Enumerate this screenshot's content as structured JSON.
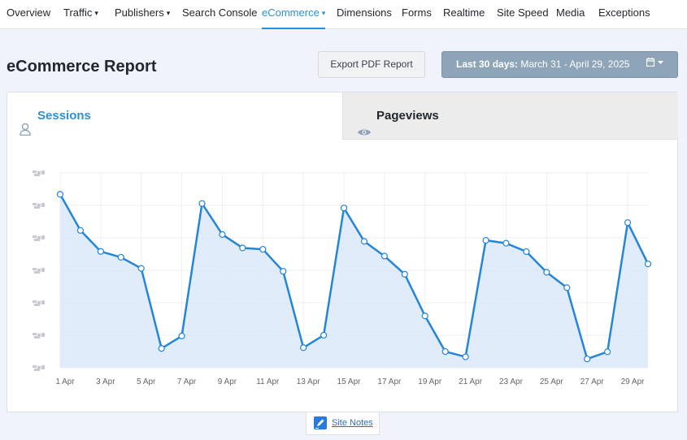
{
  "nav": {
    "items": [
      {
        "label": "Overview",
        "dropdown": false,
        "active": false
      },
      {
        "label": "Traffic",
        "dropdown": true,
        "active": false
      },
      {
        "label": "Publishers",
        "dropdown": true,
        "active": false
      },
      {
        "label": "Search Console",
        "dropdown": false,
        "active": false
      },
      {
        "label": "eCommerce",
        "dropdown": true,
        "active": true
      },
      {
        "label": "Dimensions",
        "dropdown": false,
        "active": false
      },
      {
        "label": "Forms",
        "dropdown": false,
        "active": false
      },
      {
        "label": "Realtime",
        "dropdown": false,
        "active": false
      },
      {
        "label": "Site Speed",
        "dropdown": false,
        "active": false
      },
      {
        "label": "Media",
        "dropdown": false,
        "active": false
      },
      {
        "label": "Exceptions",
        "dropdown": false,
        "active": false
      }
    ]
  },
  "header": {
    "title": "eCommerce Report",
    "export_label": "Export PDF Report",
    "date_prefix": "Last 30 days:",
    "date_range": "March 31 - April 29, 2025"
  },
  "tabs": {
    "sessions": "Sessions",
    "pageviews": "Pageviews"
  },
  "site_notes": "Site Notes",
  "colors": {
    "accent": "#2b91d8",
    "line": "#2585d6",
    "area": "#dbe9f8"
  },
  "chart_data": {
    "type": "area",
    "x": [
      "1 Apr",
      "2 Apr",
      "3 Apr",
      "4 Apr",
      "5 Apr",
      "6 Apr",
      "7 Apr",
      "8 Apr",
      "9 Apr",
      "10 Apr",
      "11 Apr",
      "12 Apr",
      "13 Apr",
      "14 Apr",
      "15 Apr",
      "16 Apr",
      "17 Apr",
      "18 Apr",
      "19 Apr",
      "20 Apr",
      "21 Apr",
      "22 Apr",
      "23 Apr",
      "24 Apr",
      "25 Apr",
      "26 Apr",
      "27 Apr",
      "28 Apr",
      "29 Apr",
      "30 Apr"
    ],
    "tick_labels": [
      "1 Apr",
      "3 Apr",
      "5 Apr",
      "7 Apr",
      "9 Apr",
      "11 Apr",
      "13 Apr",
      "15 Apr",
      "17 Apr",
      "19 Apr",
      "21 Apr",
      "23 Apr",
      "25 Apr",
      "27 Apr",
      "29 Apr"
    ],
    "y_relative": [
      0.89,
      0.705,
      0.597,
      0.567,
      0.51,
      0.099,
      0.163,
      0.843,
      0.684,
      0.615,
      0.608,
      0.495,
      0.103,
      0.167,
      0.82,
      0.649,
      0.573,
      0.48,
      0.266,
      0.083,
      0.056,
      0.654,
      0.639,
      0.596,
      0.49,
      0.411,
      0.045,
      0.082,
      0.745,
      0.533
    ],
    "ylim": [
      0,
      1
    ],
    "y_tick_labels_obscured": true,
    "grid": true
  }
}
